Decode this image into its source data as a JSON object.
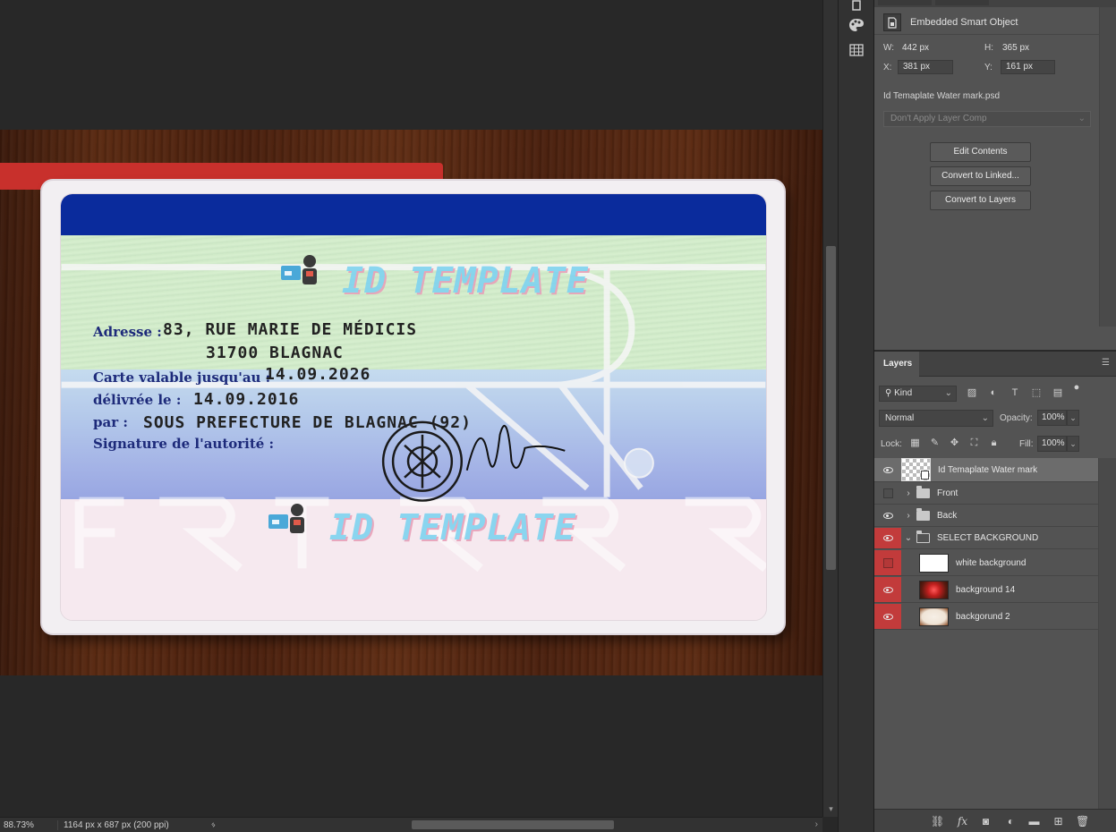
{
  "status": {
    "zoom": "88.73%",
    "doc_info": "1164 px x 687 px (200 ppi)"
  },
  "card": {
    "watermark_text": "ID TEMPLATE",
    "labels": {
      "adresse": "Adresse :",
      "valable": "Carte valable jusqu'au :",
      "delivree": "délivrée le :",
      "par": "par :",
      "signature": "Signature de l'autorité :"
    },
    "values": {
      "adresse_line1": "83, RUE MARIE DE MÉDICIS",
      "adresse_line2": "31700 BLAGNAC",
      "valable": "14.09.2026",
      "delivree": "14.09.2016",
      "par": "SOUS PREFECTURE DE BLAGNAC (92)"
    }
  },
  "properties": {
    "object_type": "Embedded Smart Object",
    "w_label": "W:",
    "w_value": "442 px",
    "h_label": "H:",
    "h_value": "365 px",
    "x_label": "X:",
    "x_value": "381 px",
    "y_label": "Y:",
    "y_value": "161 px",
    "file_name": "Id Temaplate Water mark.psd",
    "layer_comp": "Don't Apply Layer Comp",
    "buttons": {
      "edit": "Edit Contents",
      "linked": "Convert to Linked...",
      "layers": "Convert to Layers"
    }
  },
  "layers": {
    "tab": "Layers",
    "kind": "Kind",
    "blend_mode": "Normal",
    "opacity_label": "Opacity:",
    "opacity": "100%",
    "lock_label": "Lock:",
    "fill_label": "Fill:",
    "fill": "100%",
    "items": [
      {
        "name": "Id Temaplate Water mark",
        "visible": true
      },
      {
        "name": "Front",
        "visible": false
      },
      {
        "name": "Back",
        "visible": true
      },
      {
        "name": "SELECT BACKGROUND",
        "visible": true
      },
      {
        "name": "white background",
        "visible": false
      },
      {
        "name": "background 14",
        "visible": true
      },
      {
        "name": "backgorund 2",
        "visible": true
      }
    ]
  },
  "colors": {
    "canvas_bg": "#282828",
    "panel_bg": "#535353",
    "selected_layer": "#6c6c6c",
    "visibility_red": "#c23b3b",
    "card_stripe": "#0a2b9c"
  }
}
